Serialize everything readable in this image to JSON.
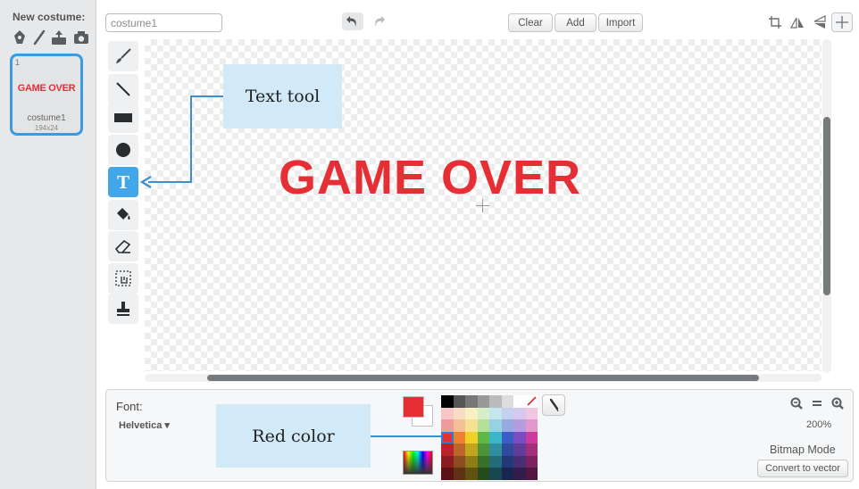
{
  "sidebar": {
    "new_costume_label": "New costume:",
    "icons": [
      "paint-new-icon",
      "paintbrush-icon",
      "upload-icon",
      "camera-icon"
    ],
    "costume": {
      "index": "1",
      "preview_text": "GAME OVER",
      "name": "costume1",
      "size": "194x24"
    }
  },
  "toolbar": {
    "costume_name": "costume1",
    "clear_label": "Clear",
    "add_label": "Add",
    "import_label": "Import",
    "right_icons": [
      "crop-icon",
      "flip-horizontal-icon",
      "flip-vertical-icon",
      "set-center-icon"
    ]
  },
  "tools": [
    "brush",
    "line",
    "rectangle",
    "ellipse",
    "text",
    "fill",
    "eraser",
    "select",
    "stamp"
  ],
  "active_tool": "text",
  "canvas": {
    "text": "GAME OVER",
    "text_color": "#e62e35"
  },
  "callouts": {
    "text_tool": "Text tool",
    "red_color": "Red color"
  },
  "bottom": {
    "font_label": "Font:",
    "font_value": "Helvetica ▾",
    "zoom": "200%",
    "mode": "Bitmap Mode",
    "convert_label": "Convert to vector"
  },
  "colors": {
    "primary": "#e62e35",
    "secondary": "#ffffff",
    "accent": "#42a6e8",
    "palette": [
      [
        "#000000",
        "#555555",
        "#777777",
        "#999999",
        "#bbbbbb",
        "#dddddd",
        "#ffffff",
        "none"
      ],
      [
        "#f7c6c6",
        "#f8dcc4",
        "#f9efc1",
        "#d7efc8",
        "#c6e6ee",
        "#c5d0ee",
        "#d7c9ee",
        "#f0c6e2"
      ],
      [
        "#ee9b9b",
        "#f2bf96",
        "#f4e191",
        "#b4e099",
        "#97d2e2",
        "#96a9e0",
        "#b59ce0",
        "#e398cb"
      ],
      [
        "#e62e35",
        "#ee8133",
        "#f0d027",
        "#5fb946",
        "#3cb4c9",
        "#3a5ec6",
        "#7a4cc0",
        "#cc3b9c"
      ],
      [
        "#b8242a",
        "#bc6528",
        "#bfa61e",
        "#4b9438",
        "#2f8fa1",
        "#2e4b9e",
        "#613d99",
        "#a32f7d"
      ],
      [
        "#8a1b20",
        "#8d4c1e",
        "#8f7c17",
        "#38702a",
        "#236b79",
        "#233877",
        "#492e73",
        "#7a235e"
      ],
      [
        "#5c1215",
        "#5e3214",
        "#5f530f",
        "#254a1c",
        "#174850",
        "#172550",
        "#311e4d",
        "#51173f"
      ]
    ]
  }
}
